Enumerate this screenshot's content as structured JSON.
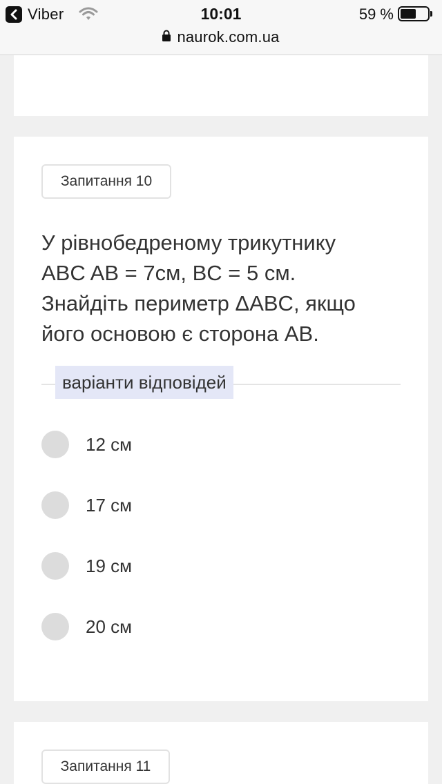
{
  "status_bar": {
    "back_app": "Viber",
    "time": "10:01",
    "battery_percent": "59 %",
    "battery_level": 0.59
  },
  "browser": {
    "url": "naurok.com.ua"
  },
  "question_10": {
    "badge": "Запитання 10",
    "text_lines": [
      "У рівнобедреному трикутнику",
      "ABC AB = 7см, BC = 5 см.",
      "Знайдіть периметр ΔABC, якщо",
      "його основою є сторона AB."
    ],
    "answers_header": "варіанти відповідей",
    "options": [
      {
        "label": "12 см"
      },
      {
        "label": "17 см"
      },
      {
        "label": "19 см"
      },
      {
        "label": "20 см"
      }
    ]
  },
  "question_11": {
    "badge": "Запитання 11"
  },
  "colors": {
    "page_bg": "#f0f0f0",
    "card_bg": "#ffffff",
    "answers_header_bg": "#e4e7f7",
    "radio": "#dcdcdc",
    "text": "#333333"
  }
}
